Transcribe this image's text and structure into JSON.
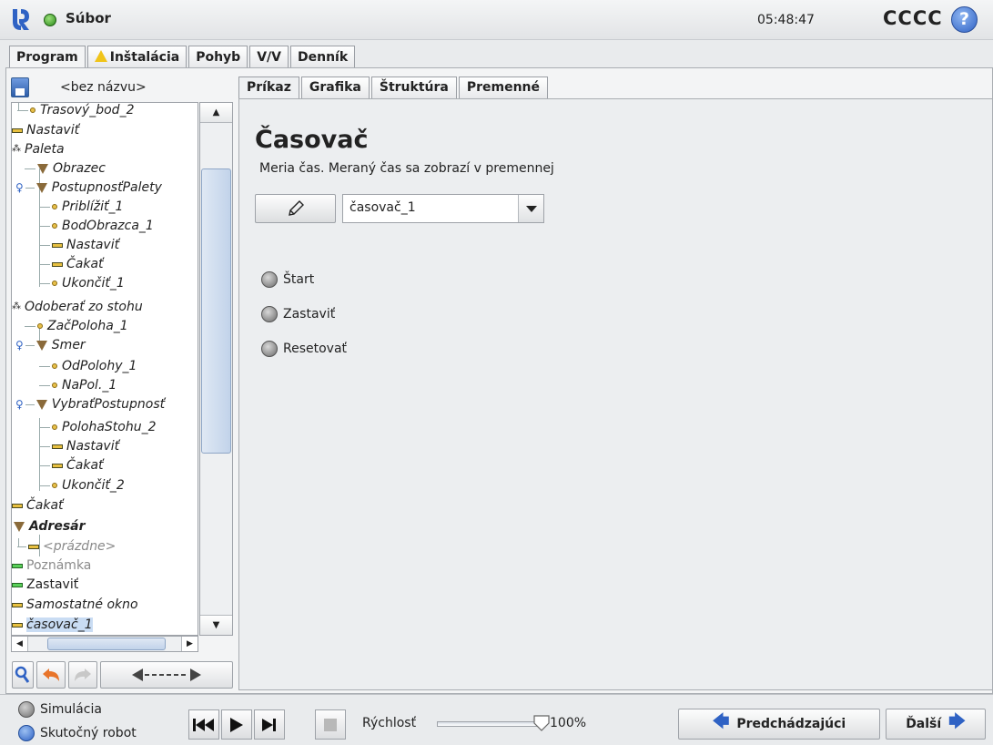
{
  "header": {
    "file_menu": "Súbor",
    "clock": "05:48:47",
    "robot_name": "CCCC",
    "help": "?"
  },
  "main_tabs": [
    {
      "label": "Program"
    },
    {
      "label": "Inštalácia"
    },
    {
      "label": "Pohyb"
    },
    {
      "label": "V/V"
    },
    {
      "label": "Denník"
    }
  ],
  "program": {
    "name": "<bez názvu>",
    "tree": [
      "Trasový_bod_2",
      "Nastaviť",
      "Paleta",
      "Obrazec",
      "PostupnosťPalety",
      "Priblížiť_1",
      "BodObrazca_1",
      "Nastaviť",
      "Čakať",
      "Ukončiť_1",
      "Odoberať zo stohu",
      "ZačPoloha_1",
      "Smer",
      "OdPolohy_1",
      "NaPol._1",
      "VybraťPostupnosť",
      "PolohaStohu_2",
      "Nastaviť",
      "Čakať",
      "Ukončiť_2",
      "Čakať",
      "Adresár",
      "<prázdne>",
      "Poznámka",
      "Zastaviť",
      "Samostatné okno",
      "časovač_1"
    ]
  },
  "sub_tabs": [
    {
      "label": "Príkaz"
    },
    {
      "label": "Grafika"
    },
    {
      "label": "Štruktúra"
    },
    {
      "label": "Premenné"
    }
  ],
  "command": {
    "title": "Časovač",
    "description": "Meria čas. Meraný čas sa zobrazí v premennej",
    "selected_timer": "časovač_1",
    "options": [
      "Štart",
      "Zastaviť",
      "Resetovať"
    ]
  },
  "bottom": {
    "mode_sim": "Simulácia",
    "mode_real": "Skutočný robot",
    "speed_label": "Rýchlosť",
    "speed_value": "100%",
    "speed_fraction": 1.0,
    "prev_label": "Predchádzajúci",
    "next_label": "Ďalší"
  },
  "colors": {
    "accent": "#2f62c4",
    "status_ok": "#2a8a1a",
    "warning": "#f0c419"
  }
}
